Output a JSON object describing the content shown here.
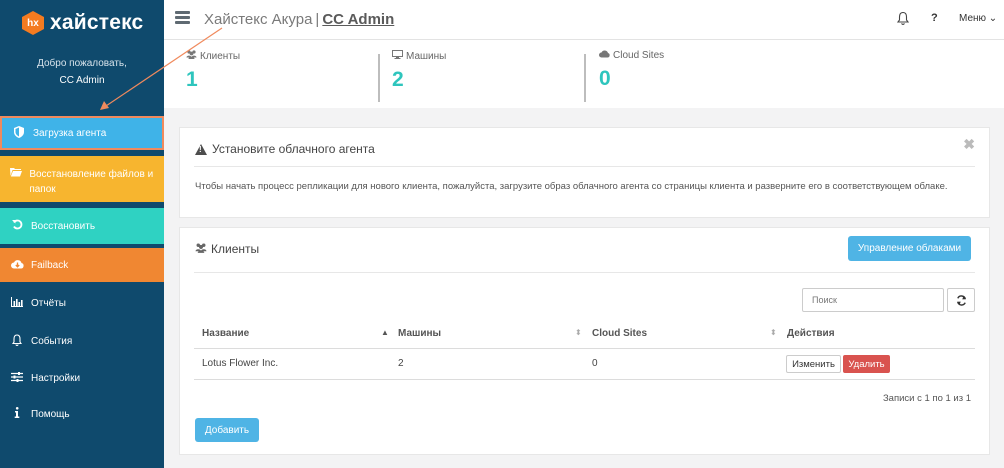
{
  "sidebar": {
    "logo_badge": "hx",
    "logo_text": "хайстекс",
    "welcome": "Добро пожаловать,",
    "username": "CC Admin",
    "items": [
      {
        "label": "Загрузка агента",
        "icon": "shield-icon"
      },
      {
        "label": "Восстановление файлов и папок",
        "icon": "folder-icon"
      },
      {
        "label": "Восстановить",
        "icon": "undo-icon"
      },
      {
        "label": "Failback",
        "icon": "cloud-download-icon"
      },
      {
        "label": "Отчёты",
        "icon": "bar-chart-icon"
      },
      {
        "label": "События",
        "icon": "bell-icon"
      },
      {
        "label": "Настройки",
        "icon": "sliders-icon"
      },
      {
        "label": "Помощь",
        "icon": "info-icon"
      }
    ]
  },
  "header": {
    "org": "Хайстекс Акура",
    "separator": "|",
    "admin": "CC Admin",
    "help": "?",
    "menu": "Меню ⌄"
  },
  "stats": [
    {
      "label": "Клиенты",
      "value": "1",
      "icon": "users-icon"
    },
    {
      "label": "Машины",
      "value": "2",
      "icon": "monitor-icon"
    },
    {
      "label": "Cloud Sites",
      "value": "0",
      "icon": "cloud-icon"
    }
  ],
  "alert": {
    "title": "Установите облачного агента",
    "close": "✖",
    "text": "Чтобы начать процесс репликации для нового клиента, пожалуйста, загрузите образ облачного агента со страницы клиента и разверните его в соответствующем облаке."
  },
  "clients": {
    "title": "Клиенты",
    "manage_button": "Управление облаками",
    "search_placeholder": "Поиск",
    "columns": [
      "Название",
      "Машины",
      "Cloud Sites",
      "Действия"
    ],
    "rows": [
      {
        "name": "Lotus Flower Inc.",
        "machines": "2",
        "cloud_sites": "0"
      }
    ],
    "edit_button": "Изменить",
    "delete_button": "Удалить",
    "records": "Записи с 1 по 1 из 1",
    "add_button": "Добавить"
  },
  "colors": {
    "sidebar_bg": "#0f4a6d",
    "upload": "#3fb3e8",
    "recover": "#f7b52f",
    "restore": "#2fd2c2",
    "failback": "#f08732",
    "stat_value": "#2ec5bd",
    "primary_button": "#4fb4e5",
    "danger_button": "#d9534f"
  }
}
